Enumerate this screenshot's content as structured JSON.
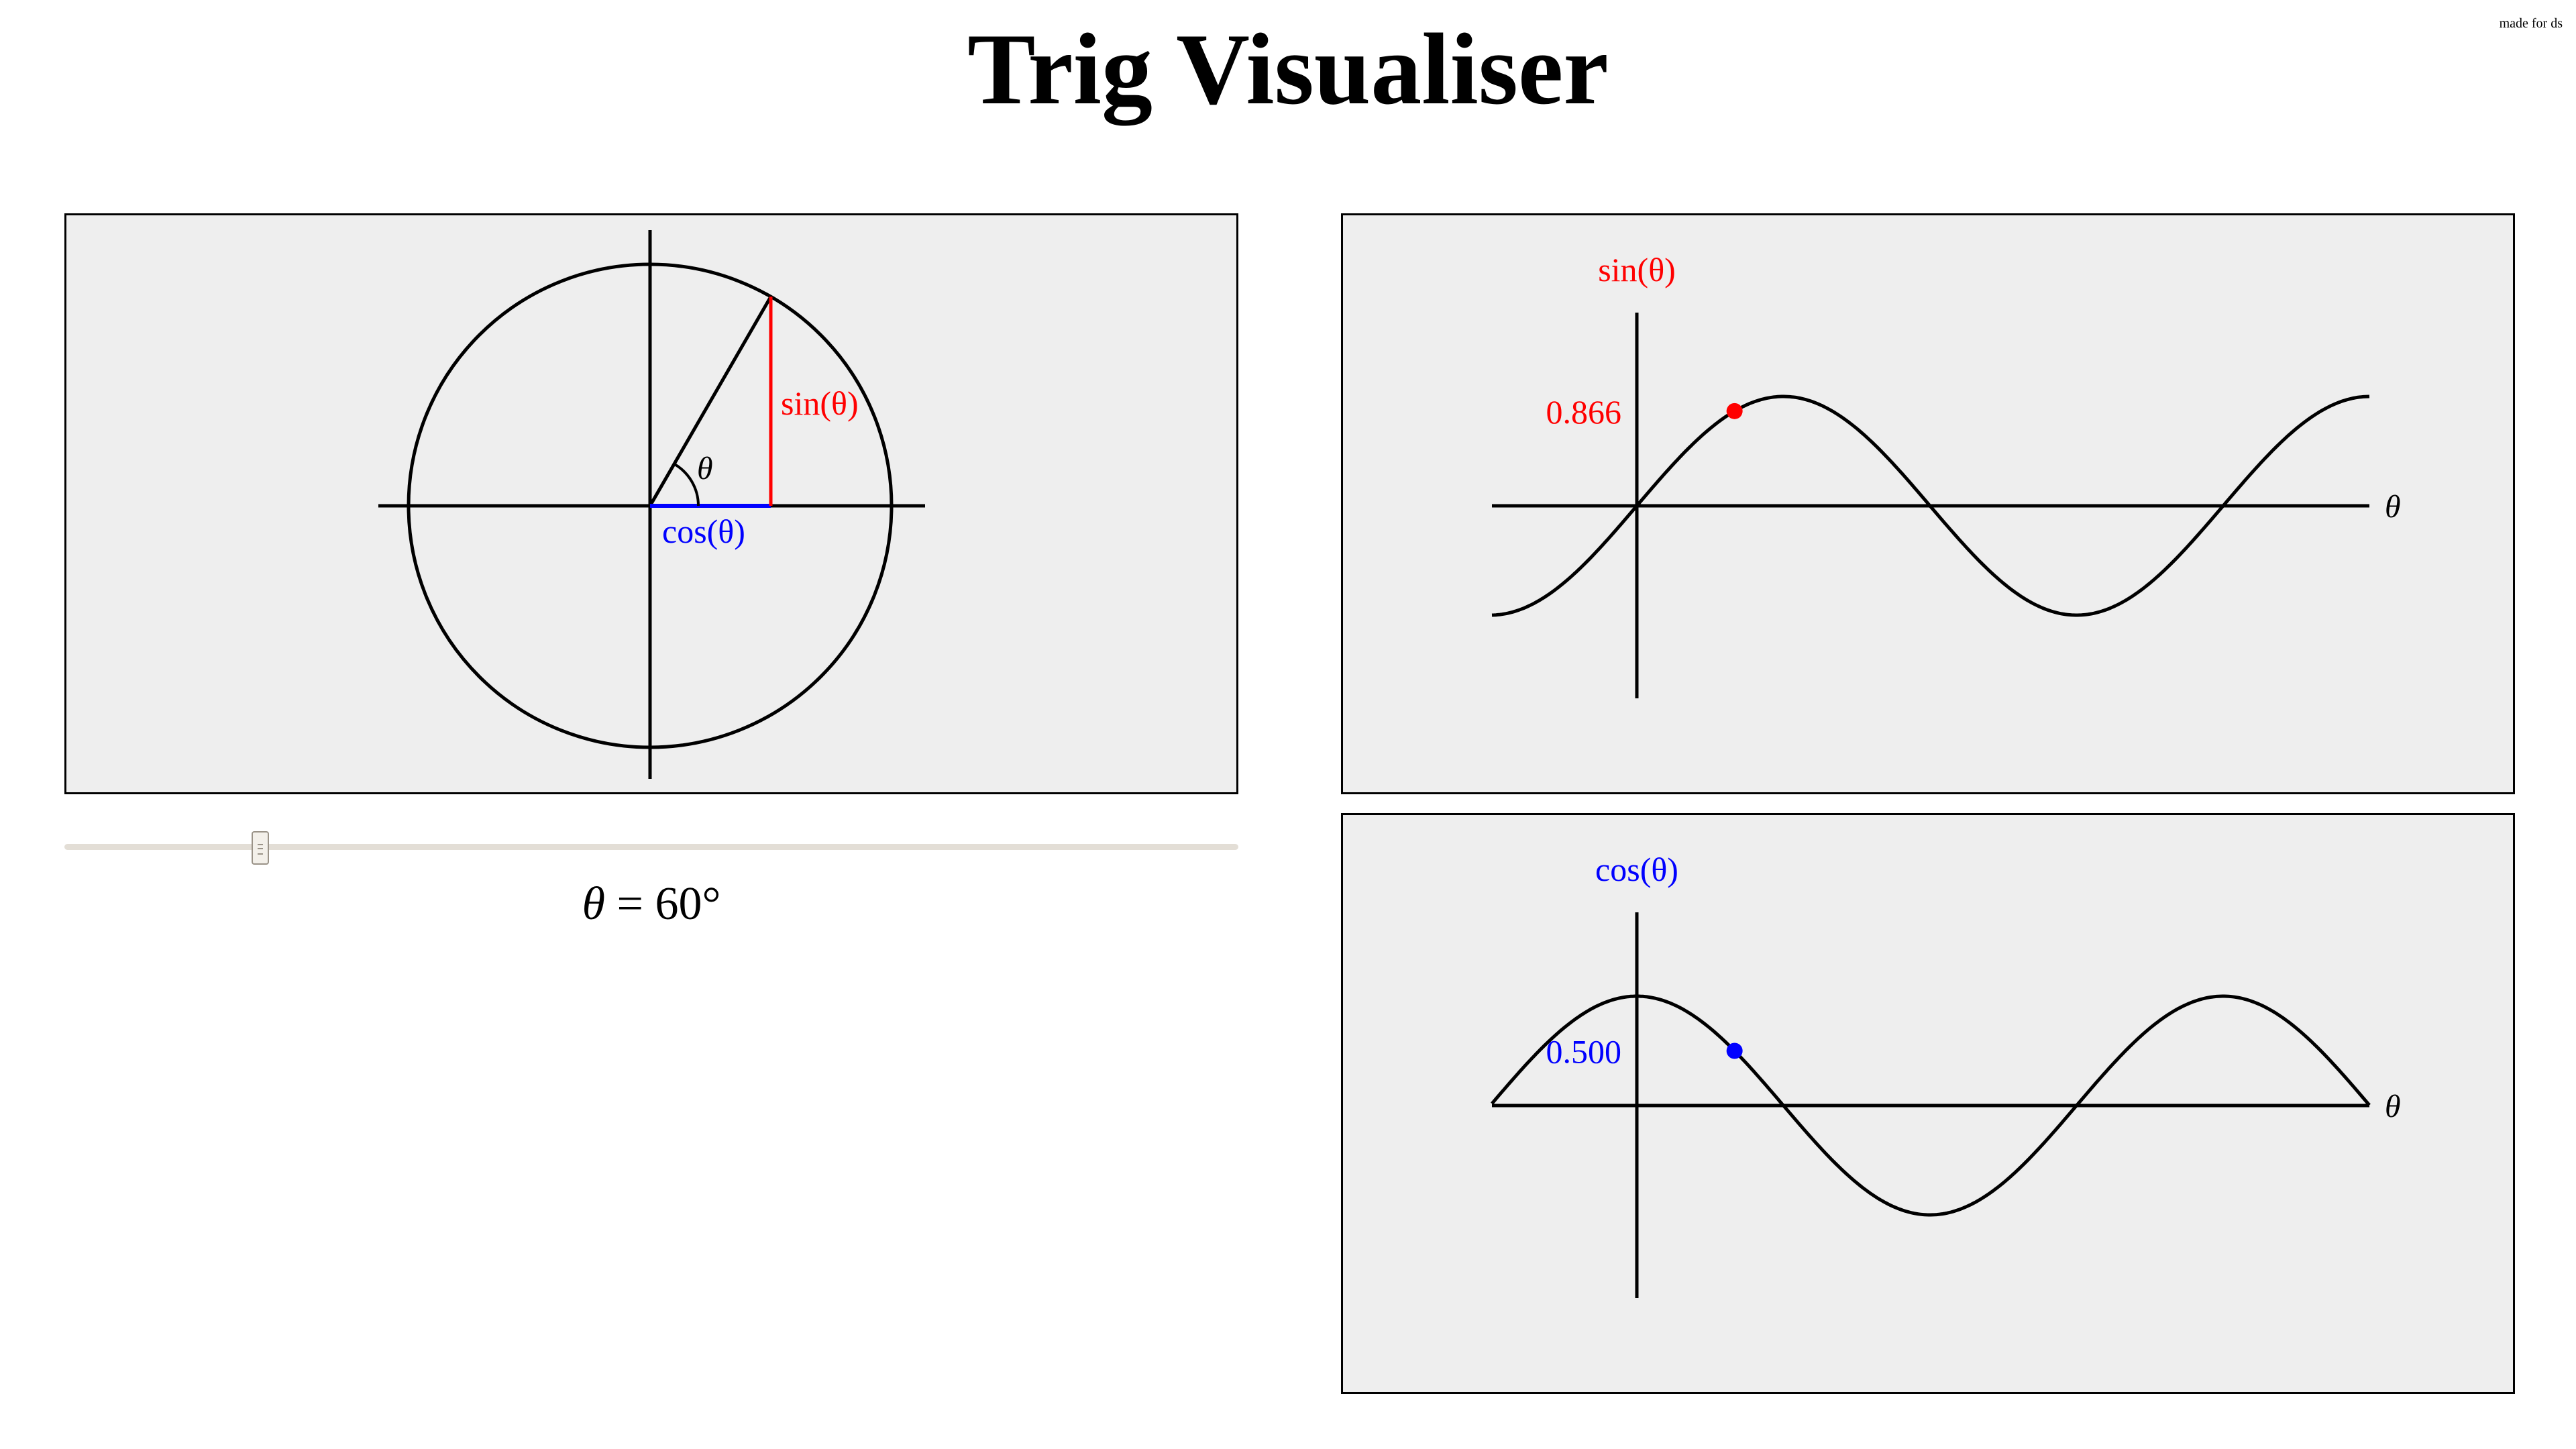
{
  "page": {
    "title": "Trig Visualiser",
    "made_for": "made for ds"
  },
  "theta_symbol": "θ",
  "theta_degrees": 60,
  "slider": {
    "min": 0,
    "max": 360,
    "value": 60
  },
  "readout": {
    "equals": " = ",
    "value": "60°"
  },
  "labels": {
    "sin": "sin(θ)",
    "cos": "cos(θ)",
    "theta": "θ"
  },
  "sin_graph": {
    "value_label": "0.866",
    "value": 0.866
  },
  "cos_graph": {
    "value_label": "0.500",
    "value": 0.5
  },
  "colors": {
    "sin": "#ff0000",
    "cos": "#0000ff",
    "panel_bg": "#eeeeee"
  }
}
